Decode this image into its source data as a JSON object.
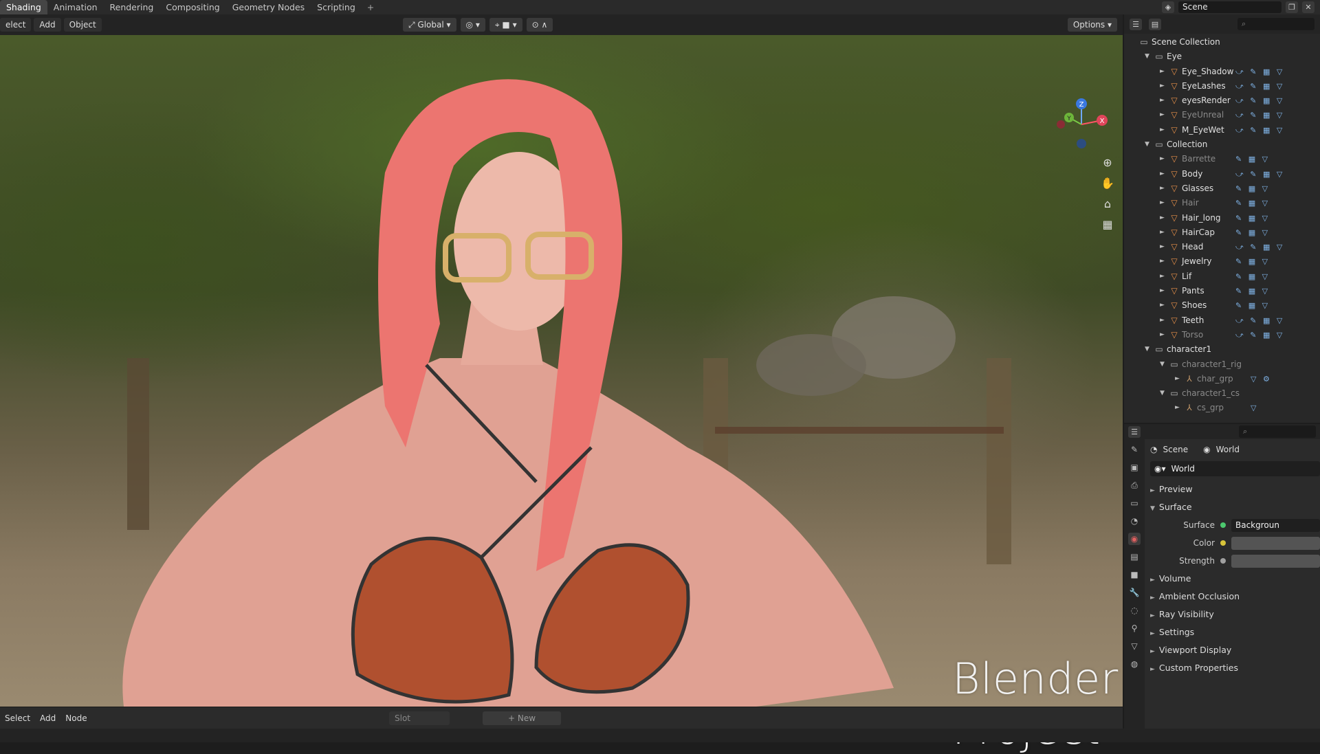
{
  "topbar": {
    "tabs": [
      "Shading",
      "Animation",
      "Rendering",
      "Compositing",
      "Geometry Nodes",
      "Scripting"
    ],
    "add_tab": "+",
    "scene_name": "Scene"
  },
  "viewport": {
    "menus": [
      "elect",
      "Add",
      "Object"
    ],
    "transform_orientation": "Global",
    "options_label": "Options",
    "watermark": "Blender Project",
    "gizmo_axes": [
      "Z",
      "Y",
      "X"
    ]
  },
  "node_editor": {
    "menus": [
      "Select",
      "Add",
      "Node"
    ],
    "slot_label": "Slot",
    "new_label": "New"
  },
  "outliner": {
    "rows": [
      {
        "label": "Scene Collection",
        "depth": 0,
        "kind": "root",
        "arrow": "",
        "dim": false,
        "tools": ""
      },
      {
        "label": "Eye",
        "depth": 1,
        "kind": "collection",
        "arrow": "▼",
        "dim": false,
        "tools": ""
      },
      {
        "label": "Eye_Shadow",
        "depth": 2,
        "kind": "mesh",
        "arrow": "►",
        "dim": false,
        "tools": "⤻ ✎ ▦ ▽"
      },
      {
        "label": "EyeLashes",
        "depth": 2,
        "kind": "mesh",
        "arrow": "►",
        "dim": false,
        "tools": "⤻ ✎ ▦ ▽"
      },
      {
        "label": "eyesRender",
        "depth": 2,
        "kind": "mesh",
        "arrow": "►",
        "dim": false,
        "tools": "⤻ ✎ ▦ ▽"
      },
      {
        "label": "EyeUnreal",
        "depth": 2,
        "kind": "mesh",
        "arrow": "►",
        "dim": true,
        "tools": "⤻ ✎ ▦ ▽"
      },
      {
        "label": "M_EyeWet",
        "depth": 2,
        "kind": "mesh",
        "arrow": "►",
        "dim": false,
        "tools": "⤻ ✎ ▦ ▽"
      },
      {
        "label": "Collection",
        "depth": 1,
        "kind": "collection",
        "arrow": "▼",
        "dim": false,
        "tools": ""
      },
      {
        "label": "Barrette",
        "depth": 2,
        "kind": "mesh",
        "arrow": "►",
        "dim": true,
        "tools": "✎ ▦ ▽"
      },
      {
        "label": "Body",
        "depth": 2,
        "kind": "mesh",
        "arrow": "►",
        "dim": false,
        "tools": "⤻ ✎ ▦ ▽"
      },
      {
        "label": "Glasses",
        "depth": 2,
        "kind": "mesh",
        "arrow": "►",
        "dim": false,
        "tools": "✎ ▦ ▽"
      },
      {
        "label": "Hair",
        "depth": 2,
        "kind": "mesh",
        "arrow": "►",
        "dim": true,
        "tools": "✎ ▦ ▽"
      },
      {
        "label": "Hair_long",
        "depth": 2,
        "kind": "mesh",
        "arrow": "►",
        "dim": false,
        "tools": "✎ ▦ ▽"
      },
      {
        "label": "HairCap",
        "depth": 2,
        "kind": "mesh",
        "arrow": "►",
        "dim": false,
        "tools": "✎ ▦ ▽"
      },
      {
        "label": "Head",
        "depth": 2,
        "kind": "mesh",
        "arrow": "►",
        "dim": false,
        "tools": "⤻ ✎ ▦ ▽"
      },
      {
        "label": "Jewelry",
        "depth": 2,
        "kind": "mesh",
        "arrow": "►",
        "dim": false,
        "tools": "✎ ▦ ▽"
      },
      {
        "label": "Lif",
        "depth": 2,
        "kind": "mesh",
        "arrow": "►",
        "dim": false,
        "tools": "✎ ▦ ▽"
      },
      {
        "label": "Pants",
        "depth": 2,
        "kind": "mesh",
        "arrow": "►",
        "dim": false,
        "tools": "✎ ▦ ▽"
      },
      {
        "label": "Shoes",
        "depth": 2,
        "kind": "mesh",
        "arrow": "►",
        "dim": false,
        "tools": "✎ ▦ ▽"
      },
      {
        "label": "Teeth",
        "depth": 2,
        "kind": "mesh",
        "arrow": "►",
        "dim": false,
        "tools": "⤻ ✎ ▦ ▽"
      },
      {
        "label": "Torso",
        "depth": 2,
        "kind": "mesh",
        "arrow": "►",
        "dim": true,
        "tools": "⤻ ✎ ▦ ▽"
      },
      {
        "label": "character1",
        "depth": 1,
        "kind": "collection",
        "arrow": "▼",
        "dim": false,
        "tools": ""
      },
      {
        "label": "character1_rig",
        "depth": 2,
        "kind": "collection",
        "arrow": "▼",
        "dim": true,
        "tools": ""
      },
      {
        "label": "char_grp",
        "depth": 3,
        "kind": "armature",
        "arrow": "►",
        "dim": true,
        "tools": "▽ ⚙"
      },
      {
        "label": "character1_cs",
        "depth": 2,
        "kind": "collection",
        "arrow": "▼",
        "dim": true,
        "tools": ""
      },
      {
        "label": "cs_grp",
        "depth": 3,
        "kind": "armature",
        "arrow": "►",
        "dim": true,
        "tools": "▽"
      }
    ]
  },
  "properties": {
    "crumb_scene": "Scene",
    "crumb_world": "World",
    "world_name": "World",
    "panels_top": [
      "Preview",
      "Surface"
    ],
    "surface_label": "Surface",
    "surface_value": "Backgroun",
    "color_label": "Color",
    "strength_label": "Strength",
    "panels_bottom": [
      "Volume",
      "Ambient Occlusion",
      "Ray Visibility",
      "Settings",
      "Viewport Display",
      "Custom Properties"
    ]
  }
}
